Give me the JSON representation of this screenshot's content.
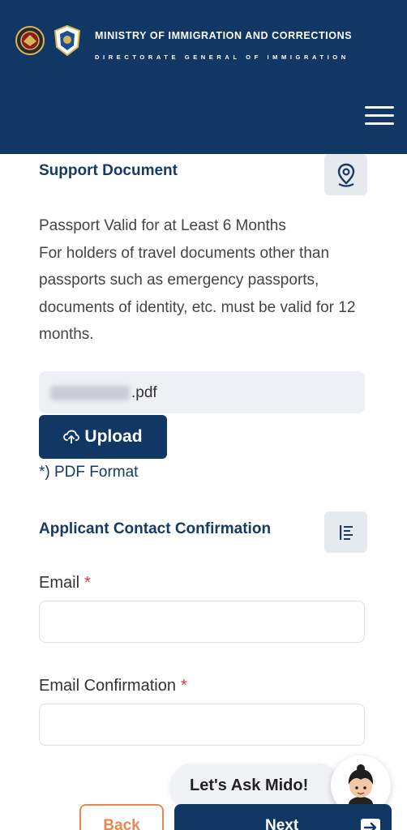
{
  "header": {
    "ministry": "MINISTRY OF IMMIGRATION AND CORRECTIONS",
    "directorate": "DIRECTORATE GENERAL OF IMMIGRATION",
    "colors": {
      "background": "#113864",
      "text": "#ffffff"
    }
  },
  "support": {
    "title": "Support Document",
    "icon": "map-pin-icon",
    "heading": "Passport Valid for at Least 6 Months",
    "body": "For holders of travel documents other than passports such as emergency passports, documents of identity, etc. must be valid for 12 months.",
    "file_name": ".pdf",
    "upload_label": "Upload",
    "format_note": "*) PDF Format"
  },
  "contact": {
    "title": "Applicant Contact Confirmation",
    "icon": "list-icon",
    "email_label": "Email",
    "email_confirm_label": "Email Confirmation",
    "required_mark": "*",
    "email_value": "",
    "email_confirm_value": ""
  },
  "assistant": {
    "text": "Let's Ask Mido!"
  },
  "nav": {
    "back_label": "Back",
    "next_label": "Next"
  },
  "colors": {
    "primary": "#113864",
    "accent": "#e6884f",
    "required": "#dd3333"
  }
}
